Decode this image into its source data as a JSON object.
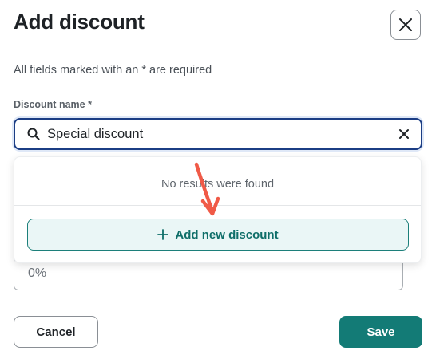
{
  "dialog": {
    "title": "Add discount",
    "required_hint": "All fields marked with an * are required"
  },
  "discount_name": {
    "label": "Discount name *",
    "value": "Special discount"
  },
  "dropdown": {
    "no_results_text": "No results were found",
    "add_button_label": "Add new discount"
  },
  "rate_field": {
    "placeholder": "0%"
  },
  "footer": {
    "cancel_label": "Cancel",
    "save_label": "Save"
  },
  "colors": {
    "accent": "#137b76",
    "focus_border": "#1b3d84",
    "annotation_arrow": "#f05a47"
  },
  "icons": [
    "close-icon",
    "search-icon",
    "clear-icon",
    "plus-icon",
    "annotation-arrow"
  ]
}
